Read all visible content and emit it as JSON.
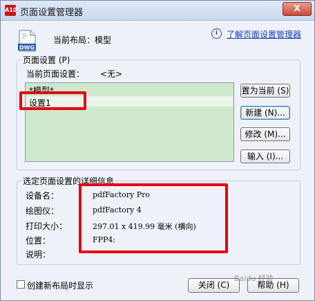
{
  "window": {
    "title": "页面设置管理器",
    "app_icon_text": "A10",
    "close_label": "X"
  },
  "header": {
    "dwg_icon_text": "DWG",
    "current_layout_label": "当前布局：",
    "current_layout_value": "模型",
    "help_link": "了解页面设置管理器"
  },
  "page_setups": {
    "group_label": "页面设置 (P)",
    "current_label": "当前页面设置：",
    "current_value": "<无>",
    "items": [
      "*模型*",
      "设置1"
    ],
    "selected_index": 1
  },
  "buttons": {
    "set_current": "置为当前 (S)",
    "new": "新建 (N)...",
    "modify": "修改 (M)...",
    "import": "输入 (I)..."
  },
  "details": {
    "group_label": "选定页面设置的详细信息",
    "rows": [
      {
        "label": "设备名：",
        "value": "pdfFactory Pro"
      },
      {
        "label": "绘图仪：",
        "value": "pdfFactory 4"
      },
      {
        "label": "打印大小：",
        "value": "297.01 x 419.99 毫米 (横向)"
      },
      {
        "label": "位置：",
        "value": "FPP4:"
      },
      {
        "label": "说明：",
        "value": ""
      }
    ]
  },
  "footer": {
    "checkbox_label": "创建新布局时显示",
    "checkbox_checked": false,
    "close_button": "关闭 (C)",
    "help_button": "帮助 (H)"
  },
  "watermark_text": "Baidu 经验",
  "colors": {
    "list_bg": "#cfe8cc",
    "annotation_red": "#e60012",
    "link_blue": "#1a3fb0"
  }
}
